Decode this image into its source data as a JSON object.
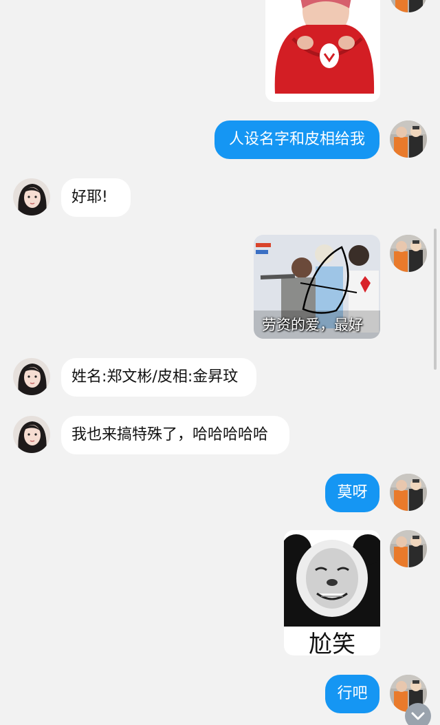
{
  "messages": {
    "m1": "人设名字和皮相给我",
    "m2": "好耶!",
    "m3_caption": "劳资的爱，最好",
    "m4": "姓名:郑文彬/皮相:金昇玟",
    "m5": "我也来搞特殊了，哈哈哈哈哈",
    "m6": "莫呀",
    "m7_sticker_text": "尬笑",
    "m8": "行吧"
  },
  "icons": {
    "scroll_down": "chevron-down-icon"
  },
  "colors": {
    "background": "#f2f2f2",
    "my_bubble": "#1596f3",
    "other_bubble": "#ffffff"
  }
}
